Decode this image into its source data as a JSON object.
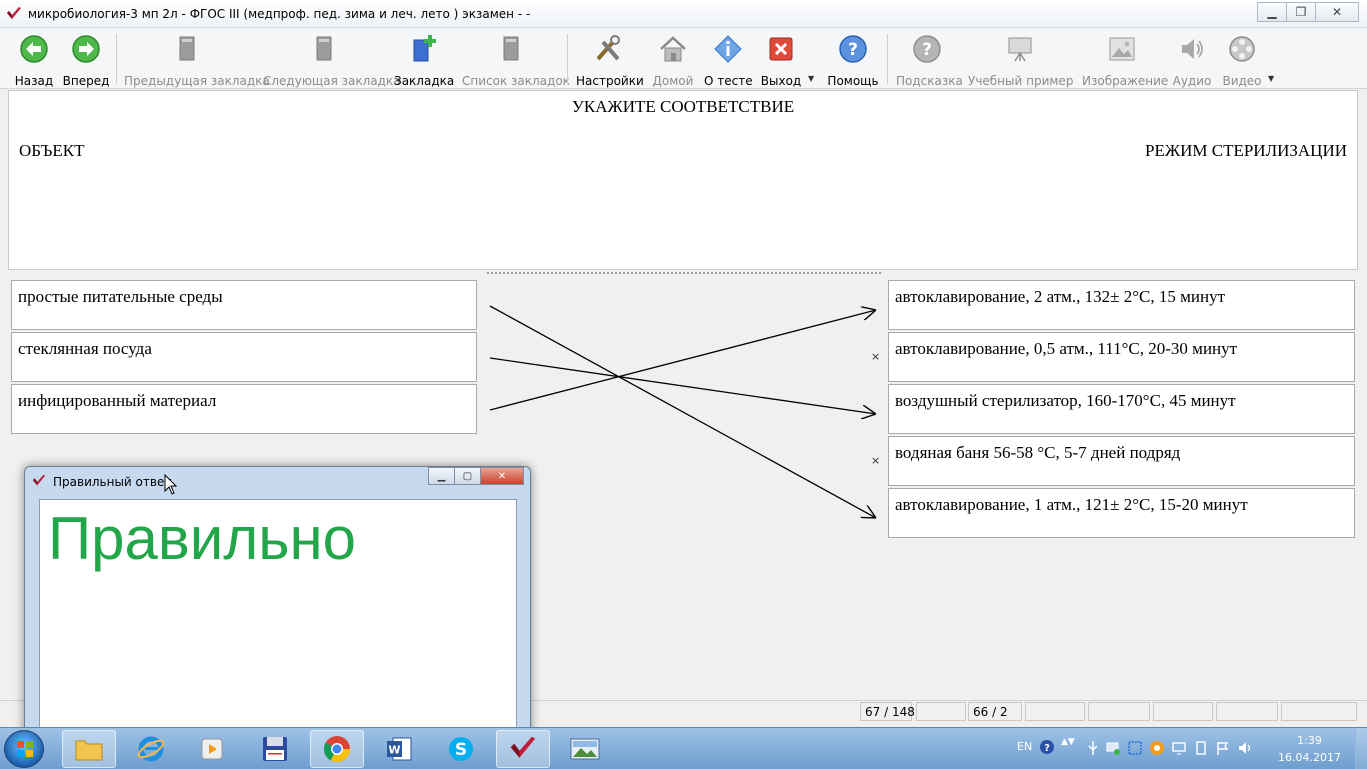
{
  "window": {
    "title": "микробиология-3 мп 2л - ФГОС III (медпроф. пед. зима и леч. лето ) экзамен -  -"
  },
  "toolbar": {
    "back": "Назад",
    "forward": "Вперед",
    "prev_bookmark": "Предыдущая закладка",
    "next_bookmark": "Следующая закладка",
    "bookmark": "Закладка",
    "bookmark_list": "Список закладок",
    "settings": "Настройки",
    "home": "Домой",
    "about": "О тесте",
    "exit": "Выход",
    "help": "Помощь",
    "hint": "Подсказка",
    "example": "Учебный пример",
    "image": "Изображение",
    "audio": "Аудио",
    "video": "Видео"
  },
  "question": {
    "title": "УКАЖИТЕ СООТВЕТСТВИЕ",
    "left_header": "ОБЪЕКТ",
    "right_header": "РЕЖИМ СТЕРИЛИЗАЦИИ"
  },
  "left_items": [
    "простые питательные среды",
    "стеклянная посуда",
    "инфицированный материал"
  ],
  "right_items": [
    "автоклавирование, 2 атм., 132± 2°C, 15 минут",
    "автоклавирование, 0,5 атм., 111°C, 20-30 минут",
    "воздушный стерилизатор, 160-170°C, 45 минут",
    "водяная баня 56-58 °C, 5-7 дней подряд",
    "автоклавирование, 1 атм., 121± 2°C, 15-20 минут"
  ],
  "connections": [
    {
      "from": 0,
      "to": 4
    },
    {
      "from": 1,
      "to": 2
    },
    {
      "from": 2,
      "to": 0
    }
  ],
  "unmatched_marker": "×",
  "unmatched_right": [
    1,
    3
  ],
  "status": {
    "progress": "67 / 148",
    "score": "66 / 2"
  },
  "dialog": {
    "title": "Правильный ответ",
    "result": "Правильно",
    "result_color": "#23a54a"
  },
  "taskbar": {
    "lang": "EN",
    "time": "1:39",
    "date": "16.04.2017"
  }
}
